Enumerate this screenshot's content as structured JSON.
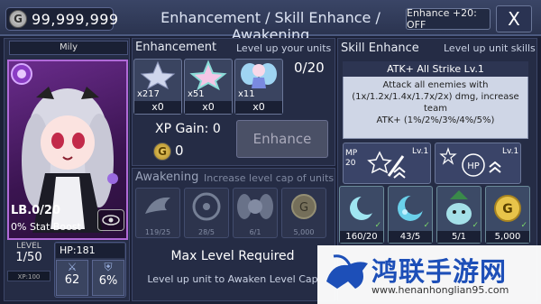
{
  "top": {
    "gold": "99,999,999",
    "title": "Enhancement / Skill Enhance / Awakening",
    "enhance_toggle": "Enhance +20: OFF",
    "close": "X"
  },
  "unit": {
    "name": "Mily",
    "lb": "LB.0/20",
    "stat_boost": "0% Stat Boost",
    "level_label": "LEVEL",
    "level": "1/50",
    "xp": "XP:100",
    "hp": "HP:181",
    "atk": "62",
    "def": "6%"
  },
  "enhancement": {
    "title": "Enhancement",
    "subtitle": "Level up your units",
    "count": "0/20",
    "items": [
      {
        "owned": "x217",
        "used": "x0",
        "icon": "silver-star-icon"
      },
      {
        "owned": "x51",
        "used": "x0",
        "icon": "rainbow-star-icon"
      },
      {
        "owned": "x11",
        "used": "x0",
        "icon": "fairy-icon"
      }
    ],
    "xp_gain_label": "XP Gain: 0",
    "coin_letter": "G",
    "cost": "0",
    "button": "Enhance"
  },
  "awakening": {
    "title": "Awakening",
    "subtitle": "Increase level cap of units",
    "slots": [
      {
        "count": "119/25",
        "icon": "wing-icon"
      },
      {
        "count": "28/5",
        "icon": "disc-icon"
      },
      {
        "count": "6/1",
        "icon": "angel-icon"
      },
      {
        "count": "5,000",
        "icon": "gold-coin-icon"
      }
    ],
    "max_level": "Max Level Required",
    "note": "Level up unit to Awaken Level Cap"
  },
  "skill": {
    "title": "Skill Enhance",
    "subtitle": "Level up unit skills",
    "name": "ATK+ All Strike Lv.1",
    "desc1": "Attack all enemies with",
    "desc2": "(1x/1.2x/1.4x/1.7x/2x) dmg, increase team",
    "desc3": "ATK+ (1%/2%/3%/4%/5%)",
    "card1_mp_label": "MP",
    "card1_mp": "20",
    "card1_lv": "Lv.1",
    "card2_lv": "Lv.1",
    "card2_hp": "HP",
    "resources": [
      {
        "count": "160/20",
        "icon": "moon-icon"
      },
      {
        "count": "43/5",
        "icon": "crescent-icon"
      },
      {
        "count": "5/1",
        "icon": "slime-icon"
      },
      {
        "count": "5,000",
        "icon": "gold-coin-icon"
      }
    ]
  },
  "watermark": {
    "text": "鸿联手游网",
    "url": "www.henanhonglian95.com"
  },
  "colors": {
    "accent": "#b06ad8",
    "watermark_blue": "#1d4fb8"
  }
}
